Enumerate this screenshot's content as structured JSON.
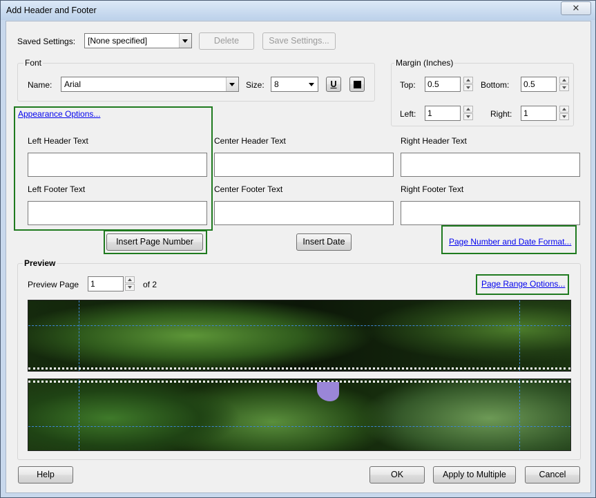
{
  "window": {
    "title": "Add Header and Footer",
    "close_glyph": "✕"
  },
  "saved_settings": {
    "label": "Saved Settings:",
    "value": "[None specified]",
    "delete_label": "Delete",
    "save_label": "Save Settings..."
  },
  "font": {
    "group_label": "Font",
    "name_label": "Name:",
    "name_value": "Arial",
    "size_label": "Size:",
    "size_value": "8",
    "underline_glyph": "U"
  },
  "margin": {
    "group_label": "Margin (Inches)",
    "top_label": "Top:",
    "top_value": "0.5",
    "bottom_label": "Bottom:",
    "bottom_value": "0.5",
    "left_label": "Left:",
    "left_value": "1",
    "right_label": "Right:",
    "right_value": "1"
  },
  "appearance_link": "Appearance Options...",
  "text_fields": {
    "left_header": "Left Header Text",
    "center_header": "Center Header Text",
    "right_header": "Right Header Text",
    "left_footer": "Left Footer Text",
    "center_footer": "Center Footer Text",
    "right_footer": "Right Footer Text"
  },
  "insert_page_number": "Insert Page Number",
  "insert_date": "Insert Date",
  "page_number_format_link": "Page Number and Date Format...",
  "preview": {
    "group_label": "Preview",
    "page_label": "Preview Page",
    "page_value": "1",
    "of_text": "of 2",
    "range_link": "Page Range Options..."
  },
  "footer_buttons": {
    "help": "Help",
    "ok": "OK",
    "apply_multiple": "Apply to Multiple",
    "cancel": "Cancel"
  },
  "colors": {
    "highlight_green": "#1f7a1f",
    "link": "#0000ee",
    "guide_lines": "#3d86d6"
  }
}
